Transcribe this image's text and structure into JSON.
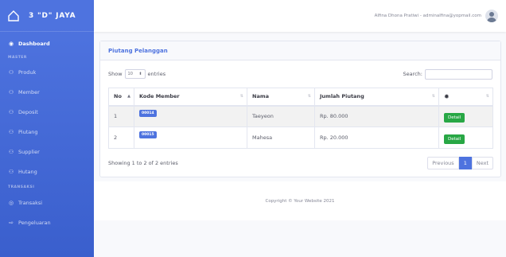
{
  "brand": {
    "title": "3 \"D\" JAYA",
    "icon": "home-icon"
  },
  "sidebar": {
    "items": [
      {
        "type": "item",
        "label": "Dashboard",
        "icon": "tachometer-icon",
        "active": true
      },
      {
        "type": "heading",
        "label": "MASTER"
      },
      {
        "type": "item",
        "label": "Produk",
        "icon": "users-icon"
      },
      {
        "type": "item",
        "label": "Member",
        "icon": "users-icon"
      },
      {
        "type": "item",
        "label": "Deposit",
        "icon": "users-icon"
      },
      {
        "type": "item",
        "label": "Piutang",
        "icon": "users-icon"
      },
      {
        "type": "item",
        "label": "Supplier",
        "icon": "users-icon"
      },
      {
        "type": "item",
        "label": "Hutang",
        "icon": "users-icon"
      },
      {
        "type": "heading",
        "label": "TRANSAKSI"
      },
      {
        "type": "item",
        "label": "Transaksi",
        "icon": "cart-icon"
      },
      {
        "type": "item",
        "label": "Pengeluaran",
        "icon": "arrow-icon"
      }
    ]
  },
  "topbar": {
    "user_name": "Alfina Dhona Pratiwi - adminalfina@yopmail.com"
  },
  "card": {
    "title": "Piutang Pelanggan",
    "show_label": "Show",
    "entries_value": "10",
    "entries_label": "entries",
    "search_label": "Search:",
    "search_value": ""
  },
  "table": {
    "headers": [
      "No",
      "Kode Member",
      "Nama",
      "Jumlah Piutang"
    ],
    "action_icon": "gear-icon",
    "rows": [
      {
        "no": "1",
        "kode": "00014",
        "nama": "Taeyeon",
        "jumlah": "Rp. 80.000",
        "action": "Detail"
      },
      {
        "no": "2",
        "kode": "00015",
        "nama": "Mahesa",
        "jumlah": "Rp. 20.000",
        "action": "Detail"
      }
    ]
  },
  "pagination": {
    "info": "Showing 1 to 2 of 2 entries",
    "previous": "Previous",
    "current": "1",
    "next": "Next"
  },
  "footer": {
    "copyright": "Copyright © Your Website 2021"
  },
  "colors": {
    "primary": "#4e73df",
    "success": "#28a745"
  }
}
